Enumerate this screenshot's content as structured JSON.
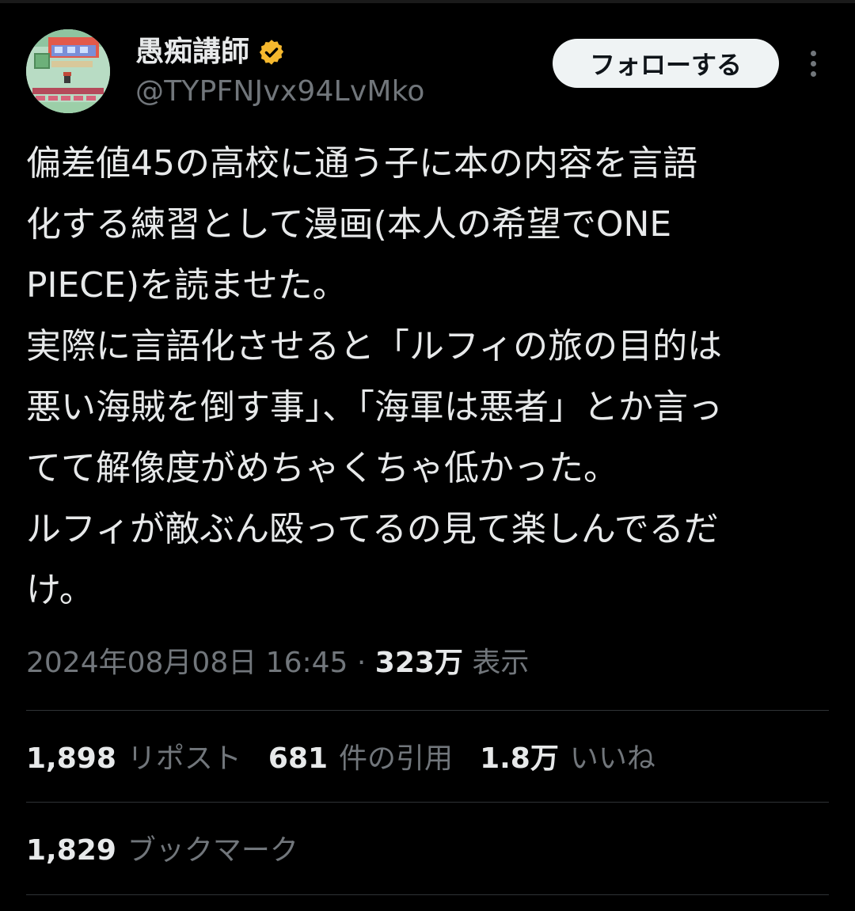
{
  "user": {
    "display_name": "愚痴講師",
    "handle": "@TYPFNJvx94LvMko",
    "verified_color": "#f5b82e"
  },
  "follow_button": {
    "label": "フォローする"
  },
  "tweet": {
    "lines": [
      "偏差値45の高校に通う子に本の内容を言語",
      "化する練習として漫画(本人の希望でONE",
      "PIECE)を読ませた。",
      "実際に言語化させると「ルフィの旅の目的は",
      "悪い海賊を倒す事」、「海軍は悪者」とか言っ",
      "てて解像度がめちゃくちゃ低かった。",
      "ルフィが敵ぶん殴ってるの見て楽しんでるだ",
      "け。"
    ]
  },
  "meta": {
    "timestamp": "2024年08月08日 16:45",
    "separator": " · ",
    "views_count": "323万",
    "views_label": "表示"
  },
  "stats": {
    "reposts": {
      "count": "1,898",
      "label": "リポスト"
    },
    "quotes": {
      "count": "681",
      "label": "件の引用"
    },
    "likes": {
      "count": "1.8万",
      "label": "いいね"
    },
    "bookmarks": {
      "count": "1,829",
      "label": "ブックマーク"
    }
  },
  "colors": {
    "background": "#000000",
    "text_primary": "#e7e9ea",
    "text_secondary": "#71767b",
    "divider": "#2f3336",
    "follow_bg": "#eff3f4"
  },
  "icons": {
    "verified": "verified-badge-icon",
    "more": "more-options-icon"
  }
}
